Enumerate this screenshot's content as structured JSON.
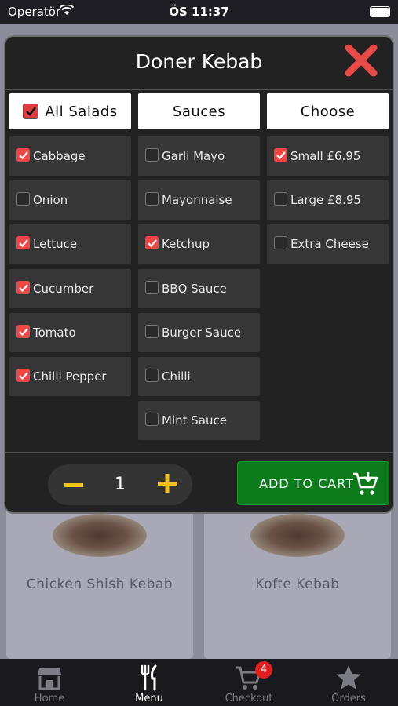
{
  "status_bar": {
    "carrier": "Operatör",
    "time": "ÖS 11:37"
  },
  "modal": {
    "title": "Doner Kebab",
    "columns": [
      {
        "header": "All Salads",
        "header_checked": true,
        "options": [
          {
            "label": "Cabbage",
            "checked": true
          },
          {
            "label": "Onion",
            "checked": false
          },
          {
            "label": "Lettuce",
            "checked": true
          },
          {
            "label": "Cucumber",
            "checked": true
          },
          {
            "label": "Tomato",
            "checked": true
          },
          {
            "label": "Chilli Pepper",
            "checked": true
          }
        ]
      },
      {
        "header": "Sauces",
        "options": [
          {
            "label": "Garli Mayo",
            "checked": false
          },
          {
            "label": "Mayonnaise",
            "checked": false
          },
          {
            "label": "Ketchup",
            "checked": true
          },
          {
            "label": "BBQ Sauce",
            "checked": false
          },
          {
            "label": "Burger Sauce",
            "checked": false
          },
          {
            "label": "Chilli",
            "checked": false
          },
          {
            "label": "Mint Sauce",
            "checked": false
          }
        ]
      },
      {
        "header": "Choose",
        "options": [
          {
            "label": "Small £6.95",
            "checked": true
          },
          {
            "label": "Large £8.95",
            "checked": false
          },
          {
            "label": "Extra Cheese",
            "checked": false
          }
        ]
      }
    ],
    "quantity": "1",
    "add_to_cart": "ADD TO CART"
  },
  "background_menu": {
    "items": [
      {
        "name": "Chicken Shish Kebab"
      },
      {
        "name": "Kofte Kebab"
      }
    ]
  },
  "tab_bar": {
    "tabs": [
      {
        "label": "Home",
        "icon": "store-icon"
      },
      {
        "label": "Menu",
        "icon": "fork-knife-icon",
        "active": true
      },
      {
        "label": "Checkout",
        "icon": "cart-icon"
      },
      {
        "label": "Orders",
        "icon": "star-icon"
      }
    ],
    "checkout_badge": "4"
  },
  "colors": {
    "accent_red": "#f04545",
    "add_button_green": "#0d7a1b",
    "stepper_yellow": "#f2c21b"
  }
}
